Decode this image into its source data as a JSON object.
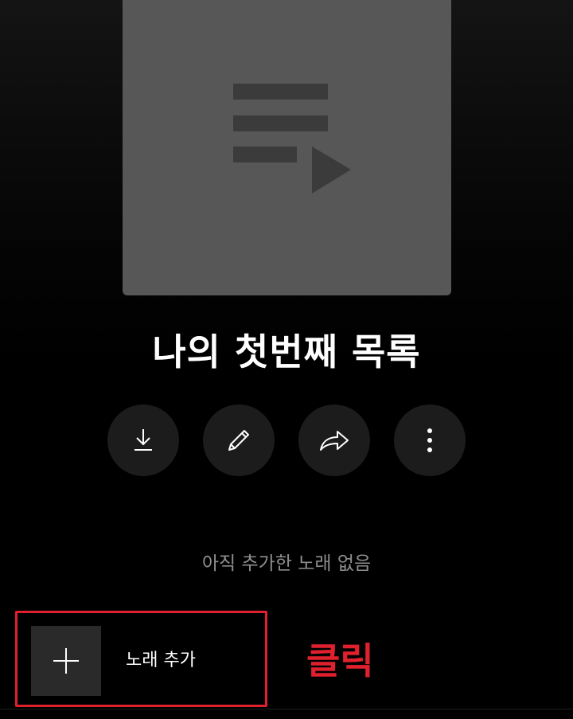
{
  "playlist": {
    "title": "나의 첫번째 목록"
  },
  "actions": {
    "download": "download",
    "edit": "edit",
    "share": "share",
    "more": "more"
  },
  "empty_state": {
    "message": "아직 추가한 노래 없음"
  },
  "add_song": {
    "label": "노래 추가"
  },
  "annotation": {
    "text": "클릭",
    "color": "#e0212d"
  },
  "colors": {
    "background": "#000000",
    "cover": "#575757",
    "button": "#1c1c1c",
    "highlight": "#e0212d"
  }
}
